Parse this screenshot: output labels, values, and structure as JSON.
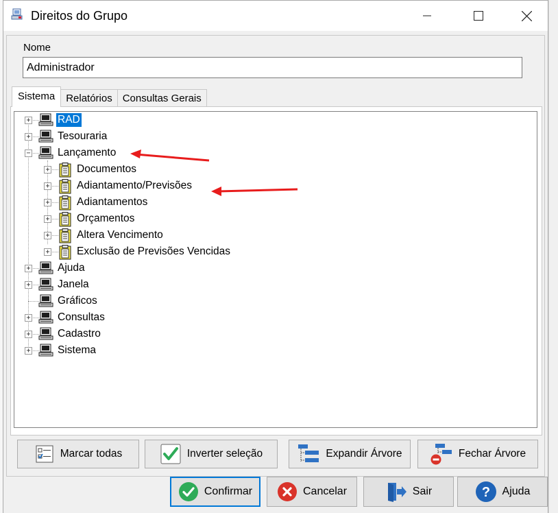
{
  "window": {
    "title": "Direitos do Grupo"
  },
  "nome": {
    "label": "Nome",
    "value": "Administrador"
  },
  "tabs": [
    {
      "label": "Sistema",
      "active": true
    },
    {
      "label": "Relatórios",
      "active": false
    },
    {
      "label": "Consultas Gerais",
      "active": false
    }
  ],
  "tree": {
    "nodes": [
      {
        "label": "RAD",
        "level": 0,
        "expander": "+",
        "icon": "computer-icon",
        "selected": true
      },
      {
        "label": "Tesouraria",
        "level": 0,
        "expander": "+",
        "icon": "computer-icon"
      },
      {
        "label": "Lançamento",
        "level": 0,
        "expander": "-",
        "icon": "computer-icon"
      },
      {
        "label": "Documentos",
        "level": 1,
        "expander": "+",
        "icon": "clipboard-icon"
      },
      {
        "label": "Adiantamento/Previsões",
        "level": 1,
        "expander": "+",
        "icon": "clipboard-icon"
      },
      {
        "label": "Adiantamentos",
        "level": 1,
        "expander": "+",
        "icon": "clipboard-icon"
      },
      {
        "label": "Orçamentos",
        "level": 1,
        "expander": "+",
        "icon": "clipboard-icon"
      },
      {
        "label": "Altera Vencimento",
        "level": 1,
        "expander": "+",
        "icon": "clipboard-icon"
      },
      {
        "label": "Exclusão de Previsões Vencidas",
        "level": 1,
        "expander": "+",
        "icon": "clipboard-icon"
      },
      {
        "label": "Ajuda",
        "level": 0,
        "expander": "+",
        "icon": "computer-icon"
      },
      {
        "label": "Janela",
        "level": 0,
        "expander": "+",
        "icon": "computer-icon"
      },
      {
        "label": "Gráficos",
        "level": 0,
        "expander": "",
        "icon": "computer-icon"
      },
      {
        "label": "Consultas",
        "level": 0,
        "expander": "+",
        "icon": "computer-icon"
      },
      {
        "label": "Cadastro",
        "level": 0,
        "expander": "+",
        "icon": "computer-icon"
      },
      {
        "label": "Sistema",
        "level": 0,
        "expander": "+",
        "icon": "computer-icon"
      }
    ]
  },
  "toolbar": {
    "marcar_todas": "Marcar todas",
    "inverter_selecao": "Inverter seleção",
    "expandir_arvore": "Expandir Árvore",
    "fechar_arvore": "Fechar Árvore"
  },
  "buttons": {
    "confirmar": "Confirmar",
    "cancelar": "Cancelar",
    "sair": "Sair",
    "ajuda": "Ajuda"
  },
  "colors": {
    "selection": "#0078d7",
    "annotation_arrow": "#e81c1c",
    "confirm_green": "#2eab58",
    "cancel_red": "#d9332a",
    "help_blue": "#1f64b8"
  }
}
